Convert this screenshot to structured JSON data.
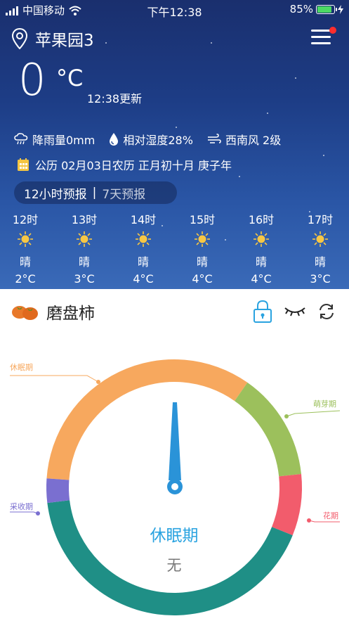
{
  "status_bar": {
    "carrier": "中国移动",
    "time": "下午12:38",
    "battery": "85%",
    "battery_level": 0.85
  },
  "header": {
    "location": "苹果园3",
    "icons": {
      "location": "location-pin-icon",
      "menu": "menu-icon"
    }
  },
  "current": {
    "temperature": "0",
    "unit": "°C",
    "updated": "12:38更新"
  },
  "details": {
    "rain": "降雨量0mm",
    "humidity": "相对湿度28%",
    "wind": "西南风 2级",
    "calendar": "公历 02月03日农历 正月初十月 庚子年"
  },
  "forecast_tabs": {
    "active": "12小时预报",
    "separator": "|",
    "inactive": "7天预报"
  },
  "hourly": [
    {
      "hour": "12时",
      "condition": "晴",
      "temp": "2°C"
    },
    {
      "hour": "13时",
      "condition": "晴",
      "temp": "3°C"
    },
    {
      "hour": "14时",
      "condition": "晴",
      "temp": "4°C"
    },
    {
      "hour": "15时",
      "condition": "晴",
      "temp": "4°C"
    },
    {
      "hour": "16时",
      "condition": "晴",
      "temp": "4°C"
    },
    {
      "hour": "17时",
      "condition": "晴",
      "temp": "3°C"
    }
  ],
  "crop": {
    "name": "磨盘柿",
    "icons": {
      "crop": "persimmon-icon",
      "lock": "lock-icon",
      "eye": "eye-closed-icon",
      "refresh": "refresh-icon"
    }
  },
  "stages": {
    "dormant": "休眠期",
    "sprouting": "萌芽期",
    "flowering": "花期",
    "harvest": "采收期"
  },
  "current_stage": {
    "name": "休眠期",
    "value": "无"
  },
  "colors": {
    "dormant": "#f7a85e",
    "sprouting": "#9cc05c",
    "flowering": "#f25c6c",
    "harvest": "#7a6fd0",
    "base": "#1f8f86",
    "accent": "#2aa3e0"
  }
}
